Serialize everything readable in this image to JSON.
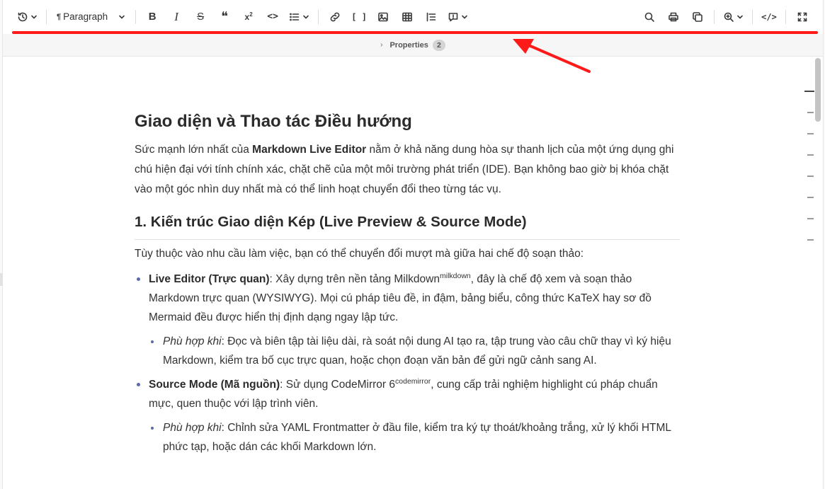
{
  "toolbar": {
    "history_icon": "history-icon",
    "paragraph_mark": "¶",
    "paragraph_label": "Paragraph",
    "bold_glyph": "B",
    "italic_glyph": "I",
    "strike_glyph": "S",
    "quote_glyph": "❝",
    "superscript_glyph": "x",
    "superscript_exp": "2",
    "code_glyph": "<>",
    "list_icon": "list-icon",
    "link_icon": "link-icon",
    "bracket_glyph": "[ ]",
    "image_icon": "image-icon",
    "table_icon": "table-icon",
    "toc_icon": "toc-icon",
    "comment_icon": "comment-icon",
    "search_icon": "search-icon",
    "print_icon": "print-icon",
    "copy_icon": "copy-icon",
    "zoom_icon": "zoom-in-icon",
    "source_glyph": "</>",
    "fullscreen_icon": "fullscreen-icon"
  },
  "properties": {
    "chevron": "›",
    "label": "Properties",
    "count": "2"
  },
  "colors": {
    "annotation_red": "#ff1a1a",
    "bullet": "#5a6aa8"
  },
  "document": {
    "h1": "Giao diện và Thao tác Điều hướng",
    "intro_1": "Sức mạnh lớn nhất của ",
    "intro_bold": "Markdown Live Editor",
    "intro_2": " nằm ở khả năng dung hòa sự thanh lịch của một ứng dụng ghi chú hiện đại với tính chính xác, chặt chẽ của một môi trường phát triển (IDE). Bạn không bao giờ bị khóa chặt vào một góc nhìn duy nhất mà có thể linh hoạt chuyển đổi theo từng tác vụ.",
    "h2": "1. Kiến trúc Giao diện Kép (Live Preview & Source Mode)",
    "p2": "Tùy thuộc vào nhu cầu làm việc, bạn có thể chuyển đổi mượt mà giữa hai chế độ soạn thảo:",
    "items": [
      {
        "title": "Live Editor (Trực quan)",
        "text_1": ": Xây dựng trên nền tảng Milkdown",
        "footnote": "milkdown",
        "text_2": ", đây là chế độ xem và soạn thảo Markdown trực quan (WYSIWYG). Mọi cú pháp tiêu đề, in đậm, bảng biểu, công thức KaTeX hay sơ đồ Mermaid đều được hiển thị định dạng ngay lập tức.",
        "sub_label": "Phù hợp khi",
        "sub_text": ": Đọc và biên tập tài liệu dài, rà soát nội dung AI tạo ra, tập trung vào câu chữ thay vì ký hiệu Markdown, kiểm tra bố cục trực quan, hoặc chọn đoạn văn bản để gửi ngữ cảnh sang AI."
      },
      {
        "title": "Source Mode (Mã nguồn)",
        "text_1": ": Sử dụng CodeMirror 6",
        "footnote": "codemirror",
        "text_2": ", cung cấp trải nghiệm highlight cú pháp chuẩn mực, quen thuộc với lập trình viên.",
        "sub_label": "Phù hợp khi",
        "sub_text": ": Chỉnh sửa YAML Frontmatter ở đầu file, kiểm tra ký tự thoát/khoảng trắng, xử lý khối HTML phức tạp, hoặc dán các khối Markdown lớn."
      }
    ]
  }
}
